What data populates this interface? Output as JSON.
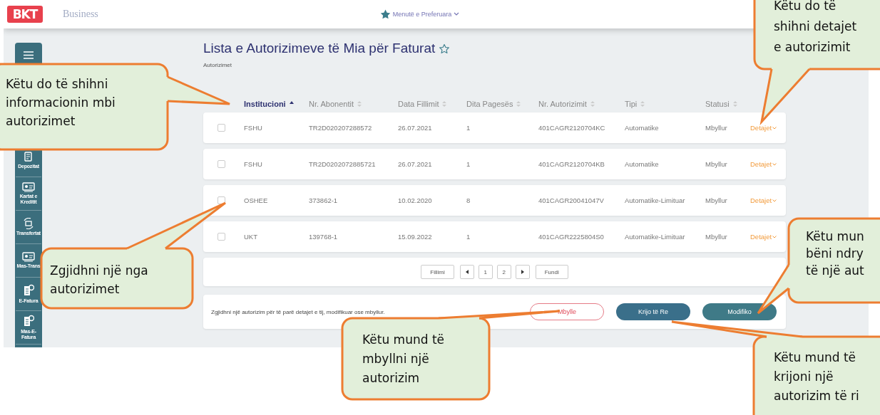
{
  "topbar": {
    "logo": "BKT",
    "brand": "Business",
    "favorites": "Menutë e Preferuara"
  },
  "sidebar": {
    "items": [
      {
        "label": "Depozitat"
      },
      {
        "label": "Kartat e Kreditit"
      },
      {
        "label": "Transfertat"
      },
      {
        "label": "Mas-Trans"
      },
      {
        "label": "E-Fatura"
      },
      {
        "label": "Mas-E-Fatura"
      }
    ]
  },
  "page": {
    "title": "Lista e Autorizimeve të Mia për Faturat",
    "favorite": false,
    "breadcrumb": "Autorizimet"
  },
  "table": {
    "columns": [
      {
        "label": "Institucioni",
        "sorted": true
      },
      {
        "label": "Nr. Abonentit",
        "sorted": false
      },
      {
        "label": "Data Fillimit",
        "sorted": false
      },
      {
        "label": "Dita Pagesës",
        "sorted": false
      },
      {
        "label": "Nr. Autorizimit",
        "sorted": false
      },
      {
        "label": "Tipi",
        "sorted": false
      },
      {
        "label": "Statusi",
        "sorted": false
      }
    ],
    "rows": [
      {
        "checked": false,
        "cells": [
          "FSHU",
          "TR2D020207288572",
          "26.07.2021",
          "1",
          "401CAGR2120704KC",
          "Automatike",
          "Mbyllur"
        ],
        "details": "Detajet"
      },
      {
        "checked": false,
        "cells": [
          "FSHU",
          "TR2D0202072885721",
          "26.07.2021",
          "1",
          "401CAGR2120704KB",
          "Automatike",
          "Mbyllur"
        ],
        "details": "Detajet"
      },
      {
        "checked": false,
        "cells": [
          "OSHEE",
          "373862-1",
          "10.02.2020",
          "8",
          "401CAGR20041047V",
          "Automatike-Limituar",
          "Mbyllur"
        ],
        "details": "Detajet"
      },
      {
        "checked": false,
        "cells": [
          "UKT",
          "139768-1",
          "15.09.2022",
          "1",
          "401CAGR2225804S0",
          "Automatike-Limituar",
          "Mbyllur"
        ],
        "details": "Detajet"
      }
    ]
  },
  "pagination": {
    "first": "Fillimi",
    "pages": [
      "1",
      "2"
    ],
    "last": "Fundi"
  },
  "actions": {
    "hint": "Zgjidhni një autorizim për të parë detajet e tij, modifikuar ose mbyllur.",
    "buttons": [
      {
        "label": "Mbylle",
        "kind": "outline"
      },
      {
        "label": "Krijo të Re",
        "kind": "primary"
      },
      {
        "label": "Modifiko",
        "kind": "secondary"
      }
    ]
  },
  "callouts": [
    {
      "text": "Këtu do të shihni\ninformacionin mbi\nautorizimet"
    },
    {
      "text": "Këtu do të\nshihni detajet\ne autorizimit"
    },
    {
      "text": "Zgjidhni një nga\nautorizimet"
    },
    {
      "text": "Këtu mun\nbëni ndry\ntë një aut"
    },
    {
      "text": "Këtu mund të\nmbyllni një\nautorizim"
    },
    {
      "text": "Këtu mund të\nkrijoni një\nautorizim të ri"
    }
  ]
}
